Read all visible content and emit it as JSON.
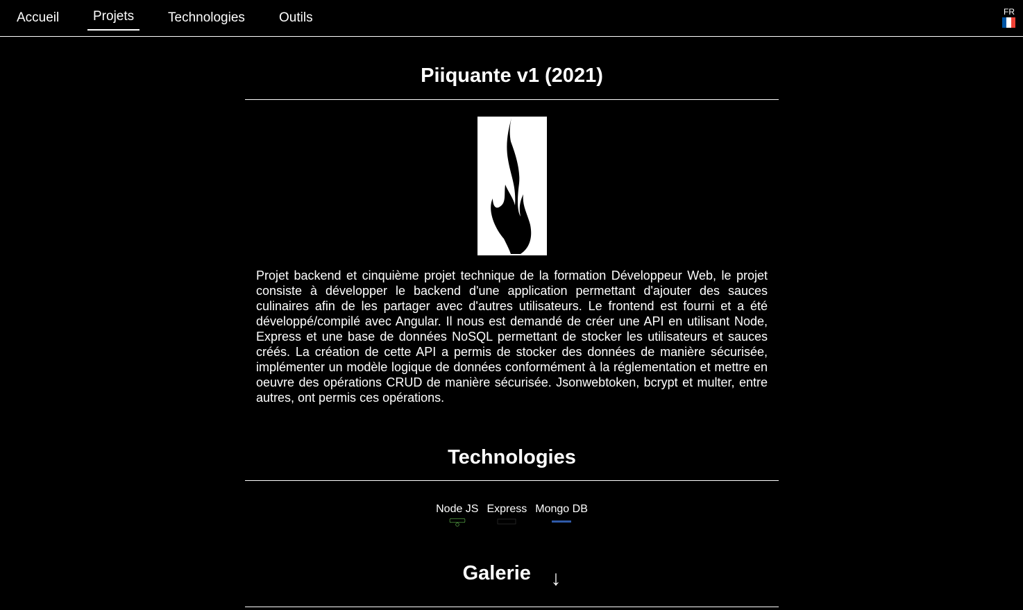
{
  "nav": {
    "items": [
      {
        "label": "Accueil",
        "active": false
      },
      {
        "label": "Projets",
        "active": true
      },
      {
        "label": "Technologies",
        "active": false
      },
      {
        "label": "Outils",
        "active": false
      }
    ],
    "language": {
      "code": "FR",
      "icon": "france-flag-icon"
    }
  },
  "project": {
    "title": "Piiquante v1 (2021)",
    "logo_icon": "flame-icon",
    "description": "Projet backend et cinquième projet technique de la formation Développeur Web, le projet consiste à développer le backend d'une application permettant d'ajouter des sauces culinaires afin de les partager avec d'autres utilisateurs. Le frontend est fourni et a été développé/compilé avec Angular. Il nous est demandé de créer une API en utilisant Node, Express et une base de données NoSQL permettant de stocker les utilisateurs et sauces créés. La création de cette API a permis de stocker des données de manière sécurisée, implémenter un modèle logique de données conformément à la réglementation et mettre en oeuvre des opérations CRUD de manière sécurisée. Jsonwebtoken, bcrypt et multer, entre autres, ont permis ces opérations."
  },
  "technologies": {
    "title": "Technologies",
    "items": [
      {
        "name": "Node JS",
        "icon": "nodejs-logo-icon"
      },
      {
        "name": "Express",
        "icon": "express-logo-icon"
      },
      {
        "name": "Mongo DB",
        "icon": "mongodb-logo-icon"
      }
    ]
  },
  "gallery": {
    "title": "Galerie",
    "arrow_icon": "arrow-down-icon",
    "arrow_glyph": "↓"
  },
  "colors": {
    "background": "#000000",
    "text": "#ffffff",
    "flag_blue": "#0055a4",
    "flag_red": "#ef4135",
    "node_green": "#539e43",
    "mongo_blue": "#2f5aa8"
  }
}
